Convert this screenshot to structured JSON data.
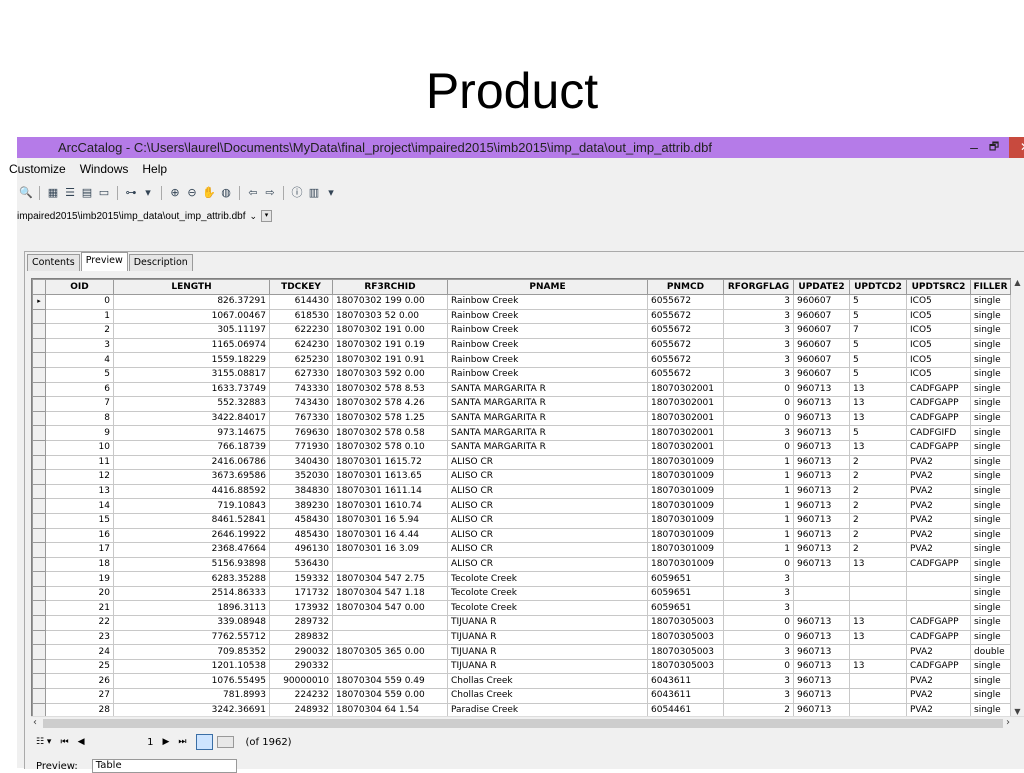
{
  "slide": {
    "title": "Product"
  },
  "window": {
    "title": "ArcCatalog - C:\\Users\\laurel\\Documents\\MyData\\final_project\\impaired2015\\imb2015\\imp_data\\out_imp_attrib.dbf",
    "min": "–",
    "max": "🗗",
    "close": "✕"
  },
  "menu": [
    "Customize",
    "Windows",
    "Help"
  ],
  "location": {
    "value": "impaired2015\\imb2015\\imp_data\\out_imp_attrib.dbf",
    "dropdown": "⌄"
  },
  "tabs": [
    "Contents",
    "Preview",
    "Description"
  ],
  "columns": [
    "OID",
    "LENGTH",
    "TDCKEY",
    "RF3RCHID",
    "PNAME",
    "PNMCD",
    "RFORGFLAG",
    "UPDATE2",
    "UPDTCD2",
    "UPDTSRC2",
    "FILLER"
  ],
  "rows": [
    [
      "0",
      "826.37291",
      "614430",
      "18070302 199 0.00",
      "Rainbow Creek",
      "6055672",
      "3",
      "960607",
      "5",
      "ICO5",
      "single"
    ],
    [
      "1",
      "1067.00467",
      "618530",
      "18070303  52 0.00",
      "Rainbow Creek",
      "6055672",
      "3",
      "960607",
      "5",
      "ICO5",
      "single"
    ],
    [
      "2",
      "305.11197",
      "622230",
      "18070302 191 0.00",
      "Rainbow Creek",
      "6055672",
      "3",
      "960607",
      "7",
      "ICO5",
      "single"
    ],
    [
      "3",
      "1165.06974",
      "624230",
      "18070302 191 0.19",
      "Rainbow Creek",
      "6055672",
      "3",
      "960607",
      "5",
      "ICO5",
      "single"
    ],
    [
      "4",
      "1559.18229",
      "625230",
      "18070302 191 0.91",
      "Rainbow Creek",
      "6055672",
      "3",
      "960607",
      "5",
      "ICO5",
      "single"
    ],
    [
      "5",
      "3155.08817",
      "627330",
      "18070303 592 0.00",
      "Rainbow Creek",
      "6055672",
      "3",
      "960607",
      "5",
      "ICO5",
      "single"
    ],
    [
      "6",
      "1633.73749",
      "743330",
      "18070302 578 8.53",
      "SANTA MARGARITA R",
      "18070302001",
      "0",
      "960713",
      "13",
      "CADFGAPP",
      "single"
    ],
    [
      "7",
      "552.32883",
      "743430",
      "18070302 578 4.26",
      "SANTA MARGARITA R",
      "18070302001",
      "0",
      "960713",
      "13",
      "CADFGAPP",
      "single"
    ],
    [
      "8",
      "3422.84017",
      "767330",
      "18070302 578 1.25",
      "SANTA MARGARITA R",
      "18070302001",
      "0",
      "960713",
      "13",
      "CADFGAPP",
      "single"
    ],
    [
      "9",
      "973.14675",
      "769630",
      "18070302 578 0.58",
      "SANTA MARGARITA R",
      "18070302001",
      "3",
      "960713",
      "5",
      "CADFGIFD",
      "single"
    ],
    [
      "10",
      "766.18739",
      "771930",
      "18070302 578 0.10",
      "SANTA MARGARITA R",
      "18070302001",
      "0",
      "960713",
      "13",
      "CADFGAPP",
      "single"
    ],
    [
      "11",
      "2416.06786",
      "340430",
      "18070301  1615.72",
      "ALISO CR",
      "18070301009",
      "1",
      "960713",
      "2",
      "PVA2",
      "single"
    ],
    [
      "12",
      "3673.69586",
      "352030",
      "18070301  1613.65",
      "ALISO CR",
      "18070301009",
      "1",
      "960713",
      "2",
      "PVA2",
      "single"
    ],
    [
      "13",
      "4416.88592",
      "384830",
      "18070301  1611.14",
      "ALISO CR",
      "18070301009",
      "1",
      "960713",
      "2",
      "PVA2",
      "single"
    ],
    [
      "14",
      "719.10843",
      "389230",
      "18070301  1610.74",
      "ALISO CR",
      "18070301009",
      "1",
      "960713",
      "2",
      "PVA2",
      "single"
    ],
    [
      "15",
      "8461.52841",
      "458430",
      "18070301  16 5.94",
      "ALISO CR",
      "18070301009",
      "1",
      "960713",
      "2",
      "PVA2",
      "single"
    ],
    [
      "16",
      "2646.19922",
      "485430",
      "18070301  16 4.44",
      "ALISO CR",
      "18070301009",
      "1",
      "960713",
      "2",
      "PVA2",
      "single"
    ],
    [
      "17",
      "2368.47664",
      "496130",
      "18070301  16 3.09",
      "ALISO CR",
      "18070301009",
      "1",
      "960713",
      "2",
      "PVA2",
      "single"
    ],
    [
      "18",
      "5156.93898",
      "536430",
      "",
      "ALISO CR",
      "18070301009",
      "0",
      "960713",
      "13",
      "CADFGAPP",
      "single"
    ],
    [
      "19",
      "6283.35288",
      "159332",
      "18070304 547 2.75",
      "Tecolote Creek",
      "6059651",
      "3",
      "",
      "",
      "",
      "single"
    ],
    [
      "20",
      "2514.86333",
      "171732",
      "18070304 547 1.18",
      "Tecolote Creek",
      "6059651",
      "3",
      "",
      "",
      "",
      "single"
    ],
    [
      "21",
      "1896.3113",
      "173932",
      "18070304 547 0.00",
      "Tecolote Creek",
      "6059651",
      "3",
      "",
      "",
      "",
      "single"
    ],
    [
      "22",
      "339.08948",
      "289732",
      "",
      "TIJUANA R",
      "18070305003",
      "0",
      "960713",
      "13",
      "CADFGAPP",
      "single"
    ],
    [
      "23",
      "7762.55712",
      "289832",
      "",
      "TIJUANA R",
      "18070305003",
      "0",
      "960713",
      "13",
      "CADFGAPP",
      "single"
    ],
    [
      "24",
      "709.85352",
      "290032",
      "18070305 365 0.00",
      "TIJUANA R",
      "18070305003",
      "3",
      "960713",
      "",
      "PVA2",
      "double"
    ],
    [
      "25",
      "1201.10538",
      "290332",
      "",
      "TIJUANA R",
      "18070305003",
      "0",
      "960713",
      "13",
      "CADFGAPP",
      "single"
    ],
    [
      "26",
      "1076.55495",
      "90000010",
      "18070304 559 0.49",
      "Chollas Creek",
      "6043611",
      "3",
      "960713",
      "",
      "PVA2",
      "single"
    ],
    [
      "27",
      "781.8993",
      "224232",
      "18070304 559 0.00",
      "Chollas Creek",
      "6043611",
      "3",
      "960713",
      "",
      "PVA2",
      "single"
    ],
    [
      "28",
      "3242.36691",
      "248932",
      "18070304  64 1.54",
      "Paradise Creek",
      "6054461",
      "2",
      "960713",
      "",
      "PVA2",
      "single"
    ]
  ],
  "nav": {
    "first": "⏮",
    "prev": "◀",
    "record": "1",
    "next": "▶",
    "last": "⏭",
    "count": "(of 1962)"
  },
  "preview": {
    "label": "Preview:",
    "value": "Table"
  },
  "row_marker": "▸"
}
